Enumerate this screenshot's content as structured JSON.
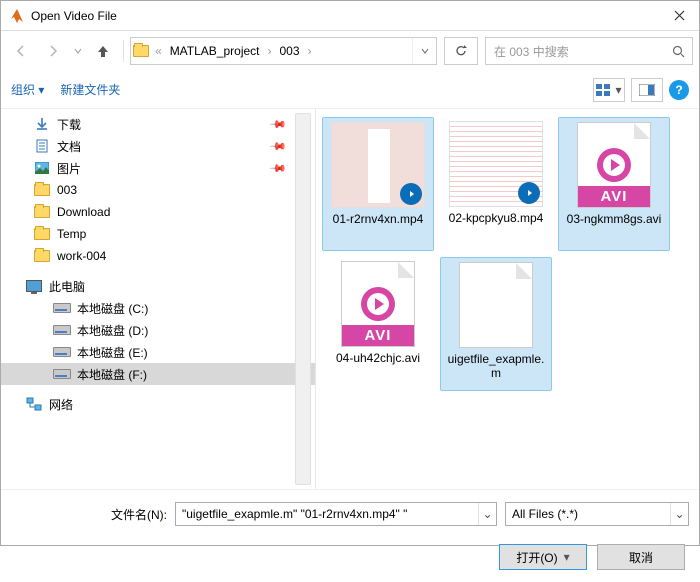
{
  "window": {
    "title": "Open Video File"
  },
  "nav": {
    "crumb1": "MATLAB_project",
    "crumb2": "003",
    "search_placeholder": "在 003 中搜索"
  },
  "toolbar": {
    "organize": "组织 ▾",
    "newfolder": "新建文件夹"
  },
  "tree": {
    "downloads": "下载",
    "documents": "文档",
    "pictures": "图片",
    "f003": "003",
    "download": "Download",
    "temp": "Temp",
    "work": "work-004",
    "thispc": "此电脑",
    "diskC": "本地磁盘 (C:)",
    "diskD": "本地磁盘 (D:)",
    "diskE": "本地磁盘 (E:)",
    "diskF": "本地磁盘 (F:)",
    "network": "网络"
  },
  "files": [
    {
      "name": "01-r2rnv4xn.mp4"
    },
    {
      "name": "02-kpcpkyu8.mp4"
    },
    {
      "name": "03-ngkmm8gs.avi"
    },
    {
      "name": "04-uh42chjc.avi"
    },
    {
      "name": "uigetfile_exapmle.m"
    }
  ],
  "avi": "AVI",
  "bottom": {
    "label": "文件名(N):",
    "value": "\"uigetfile_exapmle.m\" \"01-r2rnv4xn.mp4\" \"",
    "filter": "All Files (*.*)",
    "open": "打开(O)",
    "cancel": "取消"
  }
}
